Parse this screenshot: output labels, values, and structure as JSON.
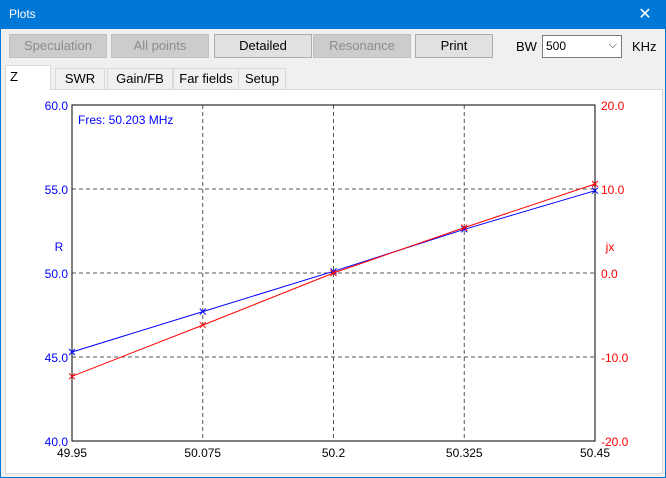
{
  "window": {
    "title": "Plots",
    "close_glyph": "✕"
  },
  "toolbar": {
    "speculation": "Speculation",
    "all_points": "All points",
    "detailed": "Detailed",
    "resonance": "Resonance",
    "print": "Print",
    "bw_label": "BW",
    "bw_value": "500",
    "bw_unit": "KHz"
  },
  "tabs": [
    "Z",
    "SWR",
    "Gain/FB",
    "Far fields",
    "Setup"
  ],
  "active_tab": "Z",
  "colors": {
    "r_series": "#0000ff",
    "jx_series": "#ff0000"
  },
  "chart_data": {
    "type": "line",
    "annotation": "Fres: 50.203 MHz",
    "x": [
      49.95,
      50.075,
      50.2,
      50.325,
      50.45
    ],
    "x_tick_labels": [
      "49.95",
      "50.075",
      "50.2",
      "50.325",
      "50.45"
    ],
    "xlim": [
      49.95,
      50.45
    ],
    "left_axis": {
      "label": "R",
      "ylim": [
        40.0,
        60.0
      ],
      "ticks": [
        "40.0",
        "45.0",
        "50.0",
        "55.0",
        "60.0"
      ]
    },
    "right_axis": {
      "label": "jx",
      "ylim": [
        -20.0,
        20.0
      ],
      "ticks": [
        "-20.0",
        "-10.0",
        "0.0",
        "10.0",
        "20.0"
      ]
    },
    "grid": true,
    "series": [
      {
        "name": "R",
        "axis": "left",
        "color": "#0000ff",
        "values": [
          45.3,
          47.7,
          50.1,
          52.6,
          54.9
        ]
      },
      {
        "name": "jx",
        "axis": "right",
        "color": "#ff0000",
        "values": [
          -12.3,
          -6.2,
          0.0,
          5.4,
          10.6
        ]
      }
    ]
  }
}
